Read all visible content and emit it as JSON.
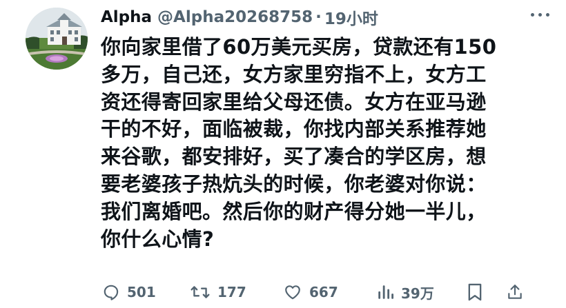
{
  "tweet": {
    "author_name": "Alpha",
    "handle": "@Alpha20268758",
    "separator": "·",
    "timestamp": "19小时",
    "lines": [
      "你向家里借了60万美元买房，贷款还有150",
      "多万，自己还，女方家里穷指不上，女方工",
      "资还得寄回家里给父母还债。女方在亚马逊",
      "干的不好，面临被裁，你找内部关系推荐她",
      "来谷歌，都安排好，买了凑合的学区房，想",
      "要老婆孩子热炕头的时候，你老婆对你说：",
      "我们离婚吧。然后你的财产得分她一半儿，",
      "你什么心情?"
    ]
  },
  "stats": {
    "replies": "501",
    "retweets": "177",
    "likes": "667",
    "views": "39万"
  },
  "icons": {
    "avatar": "house-photo-avatar",
    "more": "more-horizontal-icon",
    "reply": "reply-icon",
    "retweet": "retweet-icon",
    "like": "heart-icon",
    "views": "bar-chart-icon",
    "bookmark": "bookmark-icon",
    "share": "share-icon"
  },
  "colors": {
    "text": "#0f1419",
    "muted": "#536471"
  }
}
